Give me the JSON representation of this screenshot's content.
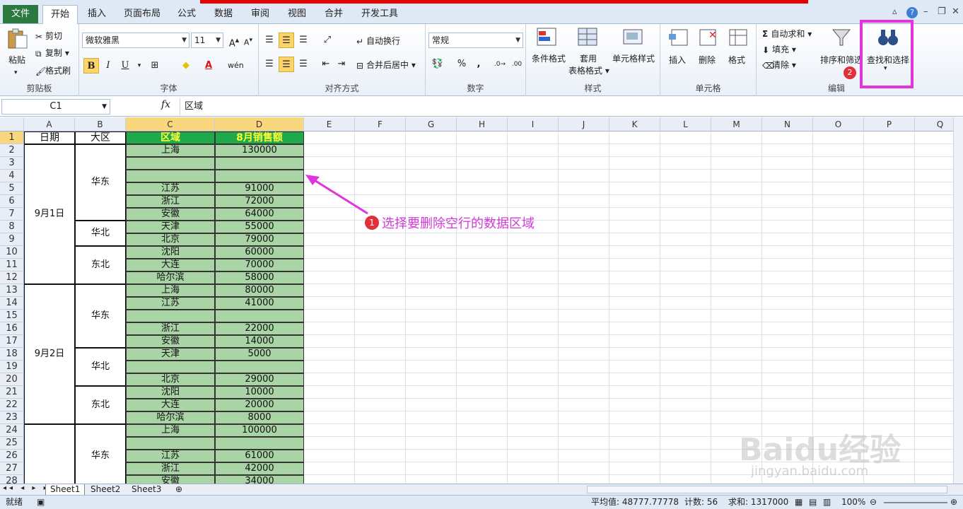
{
  "tabs": {
    "file": "文件",
    "items": [
      "开始",
      "插入",
      "页面布局",
      "公式",
      "数据",
      "审阅",
      "视图",
      "合并",
      "开发工具"
    ],
    "active": "开始"
  },
  "ribbon": {
    "clipboard": {
      "paste": "粘贴",
      "cut": "剪切",
      "copy": "复制",
      "format_painter": "格式刷",
      "label": "剪贴板"
    },
    "font": {
      "name": "微软雅黑",
      "size": "11",
      "bold": "B",
      "italic": "I",
      "underline": "U",
      "label": "字体"
    },
    "align": {
      "wrap": "自动换行",
      "merge": "合并后居中",
      "label": "对齐方式"
    },
    "number": {
      "format": "常规",
      "percent": "%",
      "comma": ",",
      "label": "数字"
    },
    "styles": {
      "cond": "条件格式",
      "table_fmt1": "套用",
      "table_fmt2": "表格格式",
      "cell_style": "单元格样式",
      "label": "样式"
    },
    "cells": {
      "insert": "插入",
      "delete": "删除",
      "format": "格式",
      "label": "单元格"
    },
    "edit": {
      "autosum": "自动求和",
      "fill": "填充",
      "clear": "清除",
      "sort": "排序和筛选",
      "find": "查找和选择",
      "label": "编辑"
    }
  },
  "formula": {
    "namebox": "C1",
    "fx": "fx",
    "content": "区域"
  },
  "columns": [
    "A",
    "B",
    "C",
    "D",
    "E",
    "F",
    "G",
    "H",
    "I",
    "J",
    "K",
    "L",
    "M",
    "N",
    "O",
    "P",
    "Q"
  ],
  "rows": [
    "1",
    "2",
    "3",
    "4",
    "5",
    "6",
    "7",
    "8",
    "9",
    "10",
    "11",
    "12",
    "13",
    "14",
    "15",
    "16",
    "17",
    "18",
    "19",
    "20",
    "21",
    "22",
    "23",
    "24",
    "25",
    "26",
    "27",
    "28"
  ],
  "header": {
    "date": "日期",
    "region_big": "大区",
    "region": "区域",
    "sales": "8月销售额"
  },
  "dates": [
    "9月1日",
    "9月2日"
  ],
  "regions_big": [
    "华东",
    "华北",
    "东北",
    "华东",
    "华北",
    "东北",
    "华东"
  ],
  "data_rows": [
    {
      "region": "上海",
      "sales": "130000"
    },
    {
      "region": "",
      "sales": ""
    },
    {
      "region": "",
      "sales": ""
    },
    {
      "region": "江苏",
      "sales": "91000"
    },
    {
      "region": "浙江",
      "sales": "72000"
    },
    {
      "region": "安徽",
      "sales": "64000"
    },
    {
      "region": "天津",
      "sales": "55000"
    },
    {
      "region": "北京",
      "sales": "79000"
    },
    {
      "region": "沈阳",
      "sales": "60000"
    },
    {
      "region": "大连",
      "sales": "70000"
    },
    {
      "region": "哈尔滨",
      "sales": "58000"
    },
    {
      "region": "上海",
      "sales": "80000"
    },
    {
      "region": "江苏",
      "sales": "41000"
    },
    {
      "region": "",
      "sales": ""
    },
    {
      "region": "浙江",
      "sales": "22000"
    },
    {
      "region": "安徽",
      "sales": "14000"
    },
    {
      "region": "天津",
      "sales": "5000"
    },
    {
      "region": "",
      "sales": ""
    },
    {
      "region": "北京",
      "sales": "29000"
    },
    {
      "region": "沈阳",
      "sales": "10000"
    },
    {
      "region": "大连",
      "sales": "20000"
    },
    {
      "region": "哈尔滨",
      "sales": "8000"
    },
    {
      "region": "上海",
      "sales": "100000"
    },
    {
      "region": "",
      "sales": ""
    },
    {
      "region": "江苏",
      "sales": "61000"
    },
    {
      "region": "浙江",
      "sales": "42000"
    },
    {
      "region": "安徽",
      "sales": "34000"
    }
  ],
  "annotation": {
    "num1": "1",
    "text": "选择要删除空行的数据区域",
    "num2": "2"
  },
  "sheets": [
    "Sheet1",
    "Sheet2",
    "Sheet3"
  ],
  "status": {
    "ready": "就绪",
    "avg": "平均值: 48777.77778",
    "count": "计数: 56",
    "sum": "求和: 1317000",
    "zoom": "100%"
  },
  "watermark": {
    "main": "Baidu经验",
    "sub": "jingyan.baidu.com"
  }
}
